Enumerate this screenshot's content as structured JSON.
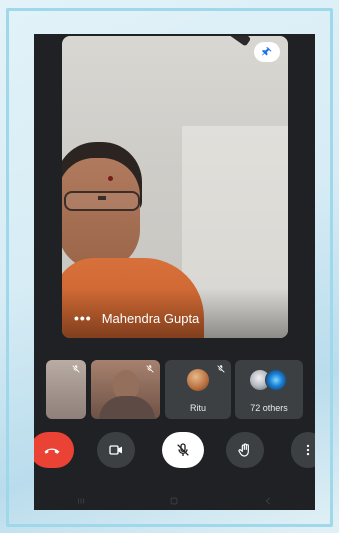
{
  "call": {
    "active_speaker": "Mahendra Gupta",
    "more_options_glyph": "•••"
  },
  "participants": [
    {
      "label": "",
      "muted": true,
      "kind": "video"
    },
    {
      "label": "",
      "muted": true,
      "kind": "video"
    },
    {
      "label": "Ritu",
      "muted": true,
      "kind": "avatar"
    },
    {
      "label": "72 others",
      "muted": false,
      "kind": "group"
    }
  ],
  "controls": [
    {
      "name": "end-call",
      "icon": "phone-hangup-icon"
    },
    {
      "name": "camera",
      "icon": "video-camera-icon"
    },
    {
      "name": "microphone",
      "icon": "mic-off-icon"
    },
    {
      "name": "raise-hand",
      "icon": "hand-icon"
    },
    {
      "name": "more",
      "icon": "more-vert-icon"
    }
  ],
  "colors": {
    "app_background": "#202124",
    "tile_background": "#3c4043",
    "end_call_red": "#ea4335",
    "frame_border": "#9fd8ea"
  }
}
